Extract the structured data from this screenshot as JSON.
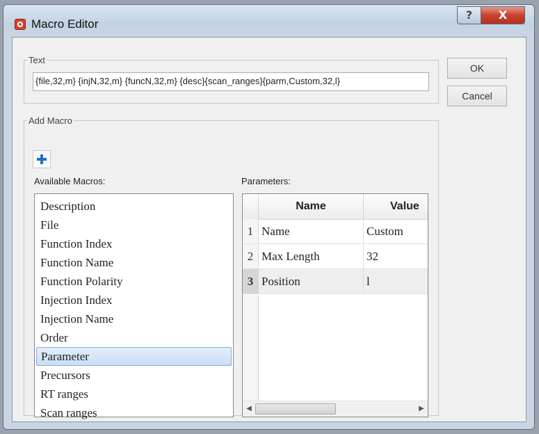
{
  "window": {
    "title": "Macro Editor",
    "help_glyph": "?",
    "close_glyph": "X"
  },
  "text_group": {
    "legend": "Text",
    "value": "{file,32,m} {injN,32,m} {funcN,32,m} {desc}{scan_ranges}{parm,Custom,32,l}"
  },
  "buttons": {
    "ok": "OK",
    "cancel": "Cancel"
  },
  "add_macro": {
    "legend": "Add Macro",
    "available_label": "Available Macros:",
    "parameters_label": "Parameters:",
    "macros": [
      "Description",
      "File",
      "Function Index",
      "Function Name",
      "Function Polarity",
      "Injection Index",
      "Injection Name",
      "Order",
      "Parameter",
      "Precursors",
      "RT ranges",
      "Scan ranges"
    ],
    "selected_macro": "Parameter",
    "grid": {
      "headers": {
        "name": "Name",
        "value": "Value"
      },
      "rows": [
        {
          "num": "1",
          "name": "Name",
          "value": "Custom"
        },
        {
          "num": "2",
          "name": "Max Length",
          "value": "32"
        },
        {
          "num": "3",
          "name": "Position",
          "value": "l"
        }
      ],
      "current_row": "3",
      "scroll_left_glyph": "◀",
      "scroll_right_glyph": "▶"
    }
  },
  "icons": {
    "app": "macro-editor-app-icon",
    "add": "plus-icon"
  },
  "colors": {
    "accent": "#1f73c6",
    "close": "#c8412c",
    "selection": "#c9def5"
  }
}
